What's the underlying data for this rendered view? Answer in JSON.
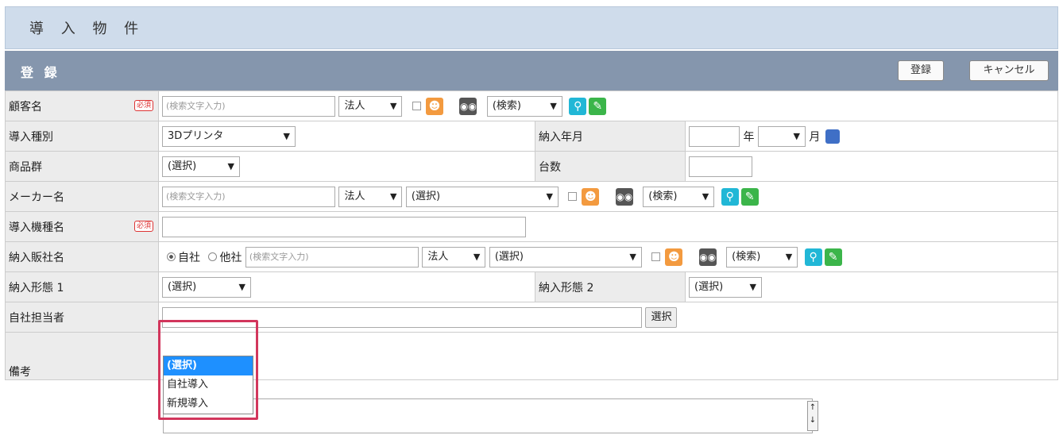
{
  "page": {
    "title": "導 入 物 件"
  },
  "section": {
    "title": "登 録",
    "register_btn": "登録",
    "cancel_btn": "キャンセル"
  },
  "rows": {
    "customer": {
      "label": "顧客名",
      "required": "必須",
      "search_placeholder": "(検索文字入力)",
      "type_select": "法人",
      "search_select": "(検索)"
    },
    "intro_type": {
      "label": "導入種別",
      "value": "3Dプリンタ",
      "delivery_label": "納入年月",
      "year_suffix": "年",
      "month_suffix": "月"
    },
    "product_group": {
      "label": "商品群",
      "value": "(選択)",
      "count_label": "台数"
    },
    "maker": {
      "label": "メーカー名",
      "search_placeholder": "(検索文字入力)",
      "type_select": "法人",
      "select_value": "(選択)",
      "search_select": "(検索)"
    },
    "model": {
      "label": "導入機種名",
      "required": "必須"
    },
    "dealer": {
      "label": "納入販社名",
      "opt_own": "自社",
      "opt_other": "他社",
      "search_placeholder": "(検索文字入力)",
      "type_select": "法人",
      "select_value": "(選択)",
      "search_select": "(検索)"
    },
    "form1": {
      "label": "納入形態 1",
      "value": "(選択)",
      "form2_label": "納入形態 2",
      "form2_value": "(選択)"
    },
    "staff": {
      "label": "自社担当者",
      "select_btn": "選択"
    },
    "notes": {
      "label": "備考"
    }
  },
  "dropdown": {
    "options": [
      "(選択)",
      "自社導入",
      "新規導入"
    ],
    "selected_index": 0
  },
  "colors": {
    "header_bg": "#cfdceb",
    "section_bg": "#8596ad",
    "highlight": "#d2365c",
    "selected_opt": "#1e90ff"
  }
}
